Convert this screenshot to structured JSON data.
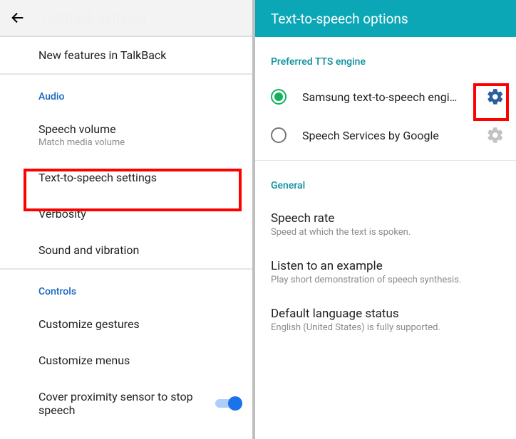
{
  "left": {
    "title": "TalkBack settings",
    "rows": {
      "new_features": "New features in TalkBack",
      "audio_header": "Audio",
      "speech_volume": "Speech volume",
      "speech_volume_sub": "Match media volume",
      "tts_settings": "Text-to-speech settings",
      "verbosity": "Verbosity",
      "sound_vib": "Sound and vibration",
      "controls_header": "Controls",
      "custom_gestures": "Customize gestures",
      "custom_menus": "Customize menus",
      "proximity": "Cover proximity sensor to stop speech"
    }
  },
  "right": {
    "title": "Text-to-speech options",
    "pref_header": "Preferred TTS engine",
    "engines": {
      "samsung": "Samsung text-to-speech engi…",
      "google": "Speech Services by Google"
    },
    "general_header": "General",
    "items": {
      "speech_rate": "Speech rate",
      "speech_rate_sub": "Speed at which the text is spoken.",
      "listen": "Listen to an example",
      "listen_sub": "Play short demonstration of speech synthesis.",
      "def_lang": "Default language status",
      "def_lang_sub": "English (United States) is fully supported."
    }
  },
  "colors": {
    "gear_active": "#2a5f9e",
    "gear_inactive": "#c2c2c2"
  }
}
